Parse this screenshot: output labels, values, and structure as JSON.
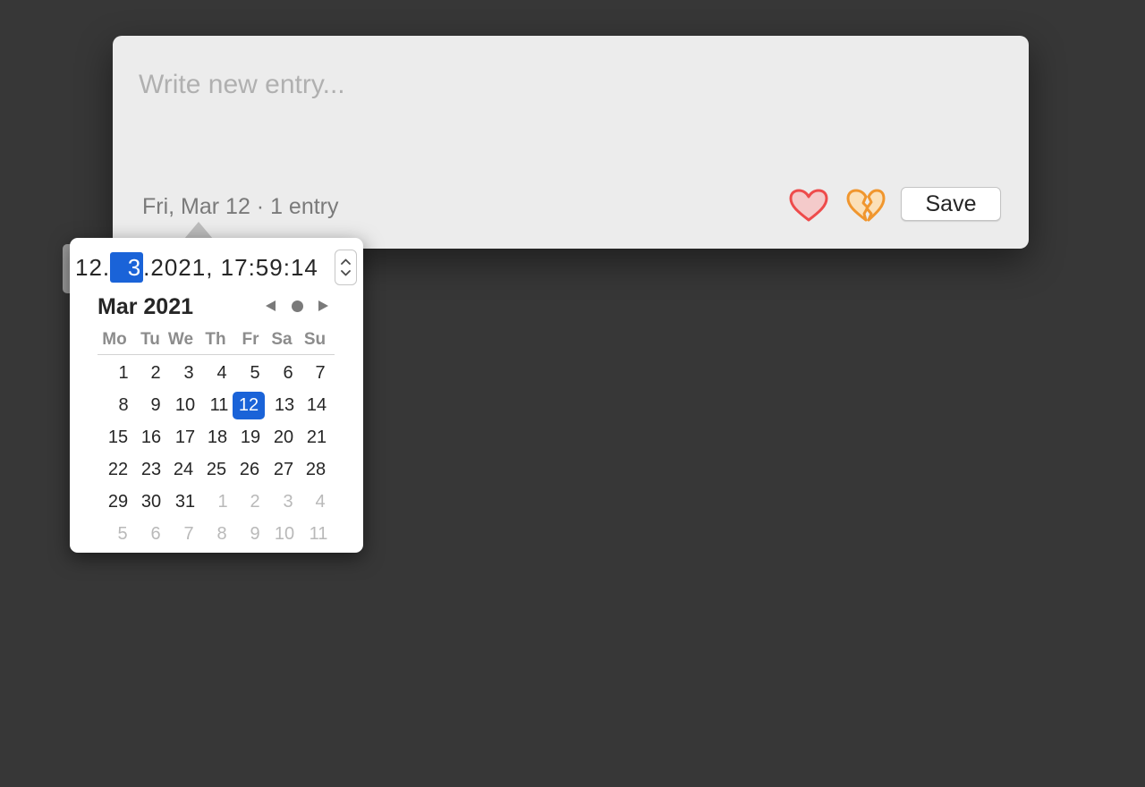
{
  "entry": {
    "placeholder": "Write new entry...",
    "date_summary": "Fri, Mar 12 · 1 entry",
    "save_label": "Save",
    "mood_icons": [
      "heart-icon",
      "broken-heart-icon"
    ],
    "colors": {
      "love": "#ee4b4b",
      "broken": "#f0962e"
    }
  },
  "datepicker": {
    "datetime": {
      "day": "12.",
      "month": "3",
      "rest": ".2021, 17:59:14"
    },
    "month_title": "Mar 2021",
    "weekdays": [
      "Mo",
      "Tu",
      "We",
      "Th",
      "Fr",
      "Sa",
      "Su"
    ],
    "weeks": [
      [
        "1",
        "2",
        "3",
        "4",
        "5",
        "6",
        "7"
      ],
      [
        "8",
        "9",
        "10",
        "11",
        "12",
        "13",
        "14"
      ],
      [
        "15",
        "16",
        "17",
        "18",
        "19",
        "20",
        "21"
      ],
      [
        "22",
        "23",
        "24",
        "25",
        "26",
        "27",
        "28"
      ],
      [
        "29",
        "30",
        "31",
        "1",
        "2",
        "3",
        "4"
      ],
      [
        "5",
        "6",
        "7",
        "8",
        "9",
        "10",
        "11"
      ]
    ],
    "selected_day": "12",
    "accent_color": "#1a63d8"
  }
}
